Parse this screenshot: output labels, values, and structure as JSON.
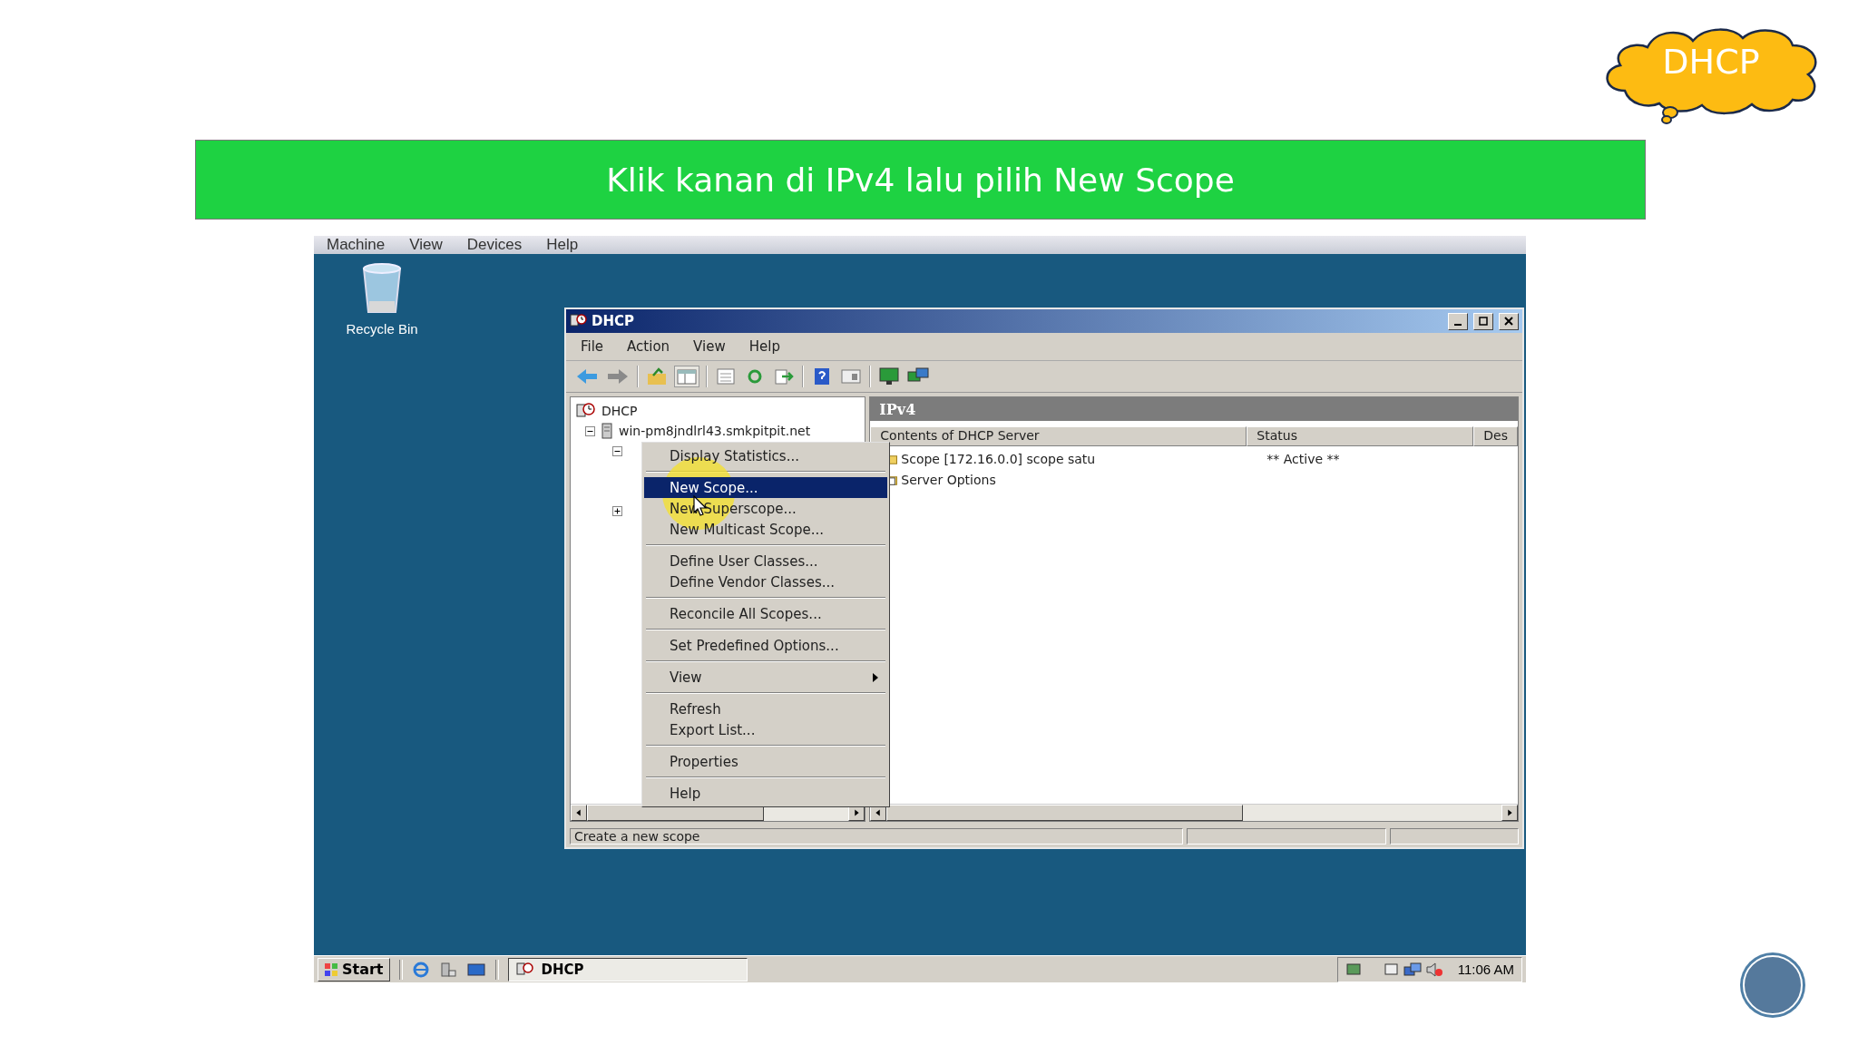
{
  "bubble": {
    "text": "DHCP"
  },
  "banner": {
    "text": "Klik kanan di IPv4 lalu pilih New Scope"
  },
  "vm_menu": [
    "Machine",
    "View",
    "Devices",
    "Help"
  ],
  "desktop_icons": [
    {
      "label": "Recycle Bin"
    }
  ],
  "window": {
    "title": "DHCP",
    "menu": [
      "File",
      "Action",
      "View",
      "Help"
    ],
    "tree": [
      {
        "label": "DHCP",
        "children": [
          {
            "label": "win-pm8jndlrl43.smkpitpit.net",
            "expanded": true,
            "children": [
              {
                "expanded": true
              },
              {
                "expanded": false
              }
            ]
          }
        ]
      }
    ],
    "pane_title": "IPv4",
    "columns": [
      "Contents of DHCP Server",
      "Status",
      "Des"
    ],
    "rows": [
      {
        "kind": "scope",
        "cells": [
          "Scope [172.16.0.0] scope satu",
          "** Active **"
        ]
      },
      {
        "kind": "options",
        "cells": [
          "Server Options"
        ]
      }
    ],
    "status_bar": "Create a new scope"
  },
  "context_menu": {
    "groups": [
      [
        {
          "label": "Display Statistics...",
          "selected": false,
          "submenu": false
        }
      ],
      [
        {
          "label": "New Scope...",
          "selected": true,
          "submenu": false
        },
        {
          "label": "New Superscope...",
          "selected": false,
          "submenu": false
        },
        {
          "label": "New Multicast Scope...",
          "selected": false,
          "submenu": false
        }
      ],
      [
        {
          "label": "Define User Classes...",
          "selected": false,
          "submenu": false
        },
        {
          "label": "Define Vendor Classes...",
          "selected": false,
          "submenu": false
        }
      ],
      [
        {
          "label": "Reconcile All Scopes...",
          "selected": false,
          "submenu": false
        }
      ],
      [
        {
          "label": "Set Predefined Options...",
          "selected": false,
          "submenu": false
        }
      ],
      [
        {
          "label": "View",
          "selected": false,
          "submenu": true
        }
      ],
      [
        {
          "label": "Refresh",
          "selected": false,
          "submenu": false
        },
        {
          "label": "Export List...",
          "selected": false,
          "submenu": false
        }
      ],
      [
        {
          "label": "Properties",
          "selected": false,
          "submenu": false
        }
      ],
      [
        {
          "label": "Help",
          "selected": false,
          "submenu": false
        }
      ]
    ]
  },
  "taskbar": {
    "start": "Start",
    "tasks": [
      {
        "label": "DHCP",
        "selected": true
      }
    ],
    "clock": "11:06 AM"
  }
}
